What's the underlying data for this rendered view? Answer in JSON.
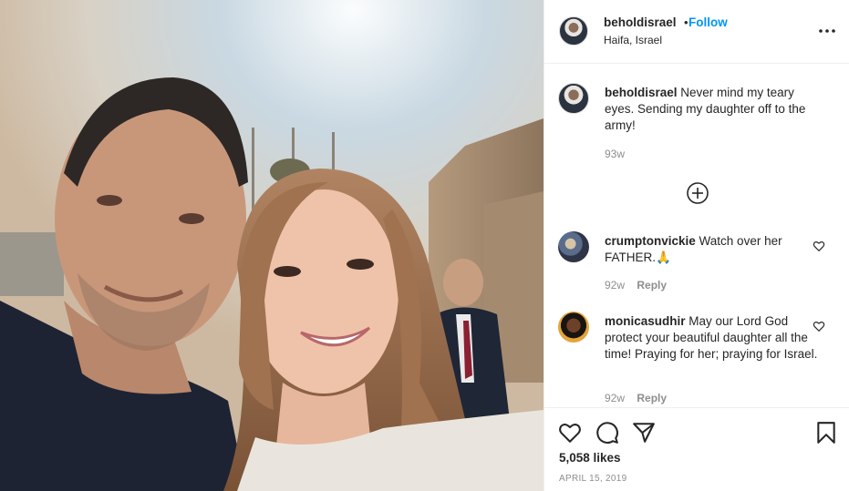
{
  "header": {
    "username": "beholdisrael",
    "separator": "•",
    "follow_label": "Follow",
    "location": "Haifa, Israel"
  },
  "caption": {
    "username": "beholdisrael",
    "text": "Never mind my teary eyes. Sending my daughter off to the army!",
    "age": "93w"
  },
  "comments": [
    {
      "username": "crumptonvickie",
      "text": "Watch over her FATHER.🙏",
      "age": "92w",
      "reply_label": "Reply"
    },
    {
      "username": "monicasudhir",
      "text": "May our Lord God protect your beautiful daughter all the time! Praying for her; praying for Israel.",
      "age": "92w",
      "reply_label": "Reply"
    }
  ],
  "footer": {
    "likes": "5,058 likes",
    "date": "APRIL 15, 2019"
  },
  "icons": {
    "more": "more-options-icon",
    "load_more": "load-more-plus-icon",
    "like": "heart-icon",
    "comment": "comment-bubble-icon",
    "share": "paper-plane-icon",
    "save": "bookmark-icon"
  }
}
